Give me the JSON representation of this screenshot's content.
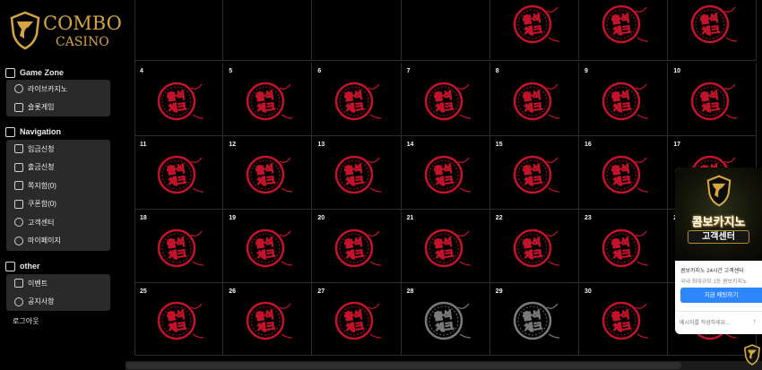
{
  "brand": {
    "line1": "COMBO",
    "line2": "CASINO",
    "gold": "#d4a640"
  },
  "sidebar": {
    "sections": [
      {
        "title": "Game Zone",
        "items": [
          {
            "label": "라이브카지노",
            "icon": "live-casino-icon"
          },
          {
            "label": "슬롯게임",
            "icon": "slot-icon"
          }
        ]
      },
      {
        "title": "Navigation",
        "items": [
          {
            "label": "입금신청",
            "icon": "deposit-icon"
          },
          {
            "label": "출금신청",
            "icon": "withdraw-icon"
          },
          {
            "label": "쪽지함(0)",
            "icon": "mail-icon"
          },
          {
            "label": "쿠폰함(0)",
            "icon": "coupon-icon"
          },
          {
            "label": "고객센터",
            "icon": "headset-icon"
          },
          {
            "label": "마이페이지",
            "icon": "gear-icon"
          }
        ]
      },
      {
        "title": "other",
        "items": [
          {
            "label": "이벤트",
            "icon": "gift-icon"
          },
          {
            "label": "공지사항",
            "icon": "megaphone-icon"
          }
        ]
      }
    ],
    "logout_label": "로그아웃"
  },
  "calendar": {
    "stamp_text_top": "출석",
    "stamp_text_bottom": "체크",
    "stamp_color_checked": "#c4122b",
    "stamp_color_unchecked": "#7a7a7a",
    "rows": [
      [
        {
          "day": "",
          "stamp": ""
        },
        {
          "day": "",
          "stamp": ""
        },
        {
          "day": "",
          "stamp": ""
        },
        {
          "day": "",
          "stamp": ""
        },
        {
          "day": "",
          "stamp": "checked"
        },
        {
          "day": "",
          "stamp": "checked"
        },
        {
          "day": "",
          "stamp": "checked"
        }
      ],
      [
        {
          "day": "4",
          "stamp": "checked"
        },
        {
          "day": "5",
          "stamp": "checked"
        },
        {
          "day": "6",
          "stamp": "checked"
        },
        {
          "day": "7",
          "stamp": "checked"
        },
        {
          "day": "8",
          "stamp": "checked"
        },
        {
          "day": "9",
          "stamp": "checked"
        },
        {
          "day": "10",
          "stamp": "checked"
        }
      ],
      [
        {
          "day": "11",
          "stamp": "checked"
        },
        {
          "day": "12",
          "stamp": "checked"
        },
        {
          "day": "13",
          "stamp": "checked"
        },
        {
          "day": "14",
          "stamp": "checked"
        },
        {
          "day": "15",
          "stamp": "checked"
        },
        {
          "day": "16",
          "stamp": "checked"
        },
        {
          "day": "17",
          "stamp": "checked"
        }
      ],
      [
        {
          "day": "18",
          "stamp": "checked"
        },
        {
          "day": "19",
          "stamp": "checked"
        },
        {
          "day": "20",
          "stamp": "checked"
        },
        {
          "day": "21",
          "stamp": "checked"
        },
        {
          "day": "22",
          "stamp": "checked"
        },
        {
          "day": "23",
          "stamp": "checked"
        },
        {
          "day": "24",
          "stamp": "checked"
        }
      ],
      [
        {
          "day": "25",
          "stamp": "checked"
        },
        {
          "day": "26",
          "stamp": "checked"
        },
        {
          "day": "27",
          "stamp": "checked"
        },
        {
          "day": "28",
          "stamp": "unchecked"
        },
        {
          "day": "29",
          "stamp": "unchecked"
        },
        {
          "day": "30",
          "stamp": "checked"
        },
        {
          "day": "",
          "stamp": "checked"
        }
      ]
    ]
  },
  "chat": {
    "title_line1": "콤보카지노",
    "title_line2": "고객센터",
    "name": "콤보카지노 24시간 고객센터",
    "subtitle": "국내 최대규모 1등 콤보카지노",
    "button_label": "지금 채팅하기",
    "input_placeholder": "메시지를 작성하세요..."
  }
}
